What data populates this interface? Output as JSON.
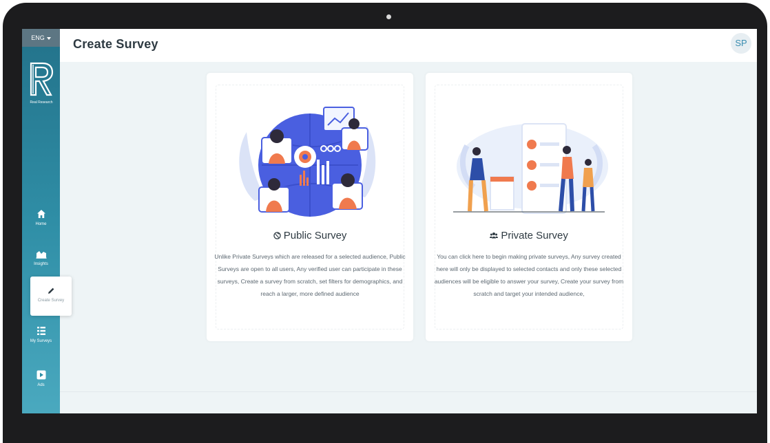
{
  "sidebar": {
    "language": "ENG",
    "logo_text": "Real Research",
    "items": [
      {
        "label": "Home"
      },
      {
        "label": "Insights"
      },
      {
        "label": "Create Survey"
      },
      {
        "label": "My Surveys"
      },
      {
        "label": "Ads"
      }
    ]
  },
  "header": {
    "title": "Create Survey",
    "avatar": "SP"
  },
  "cards": [
    {
      "title": "Public Survey",
      "icon": "globe-icon",
      "description": "Unlike Private Surveys which are released for a selected audience, Public Surveys are open to all users, Any verified user can participate in these surveys, Create a survey from scratch, set filters for demographics, and reach a larger, more defined audience"
    },
    {
      "title": "Private Survey",
      "icon": "users-icon",
      "description": "You can click here to begin making private surveys, Any survey created here will only be displayed to selected contacts and only these selected audiences will be eligible to answer your survey, Create your survey from scratch and target your intended audience,"
    }
  ],
  "colors": {
    "sidebar": "#2f8ea6",
    "accent": "#4a5fe0",
    "illustration_orange": "#f07a4e"
  }
}
